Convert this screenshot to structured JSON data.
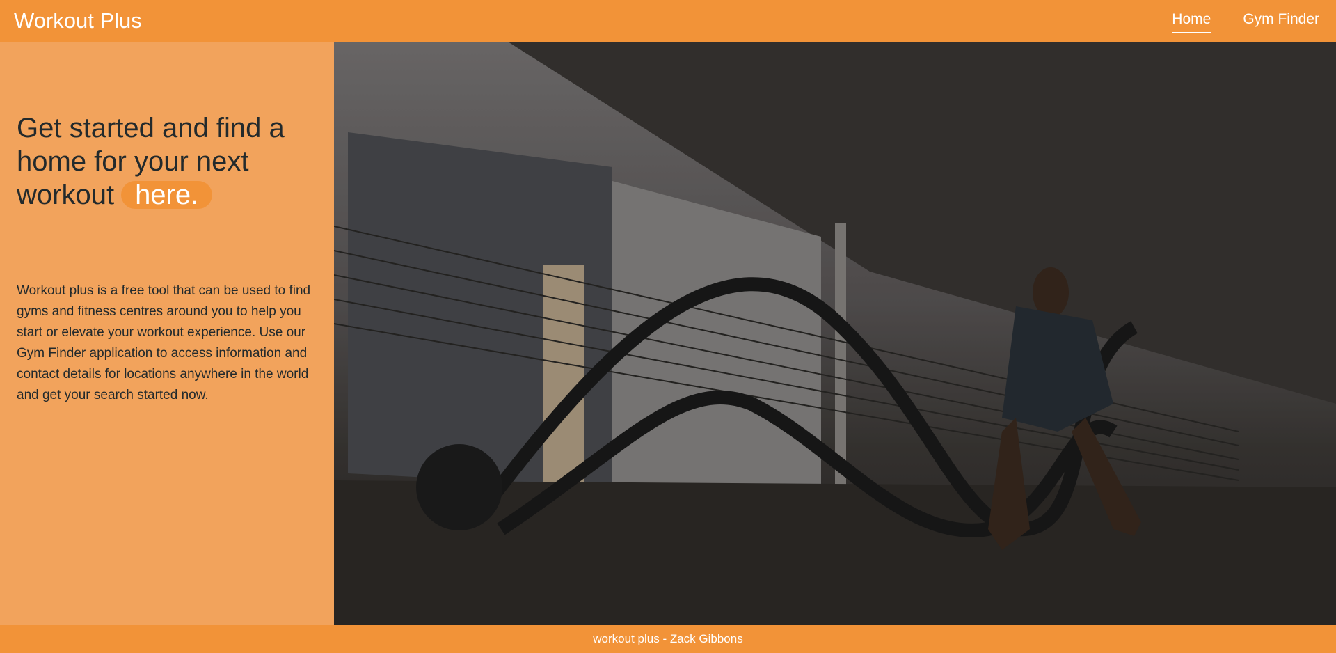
{
  "navbar": {
    "brand": "Workout Plus",
    "links": [
      {
        "label": "Home",
        "active": true
      },
      {
        "label": "Gym Finder",
        "active": false
      }
    ]
  },
  "intro": {
    "headline": "Get started and find a home for your next workout",
    "highlight": "here.",
    "description": "Workout plus is a free tool that can be used to find gyms and fitness centres around you to help you start or elevate your workout experience. Use our Gym Finder application to access information and contact details for locations anywhere in the world and get your search started now."
  },
  "hero": {
    "icon": "hero-photo-battle-ropes"
  },
  "footer": {
    "text": "workout plus - Zack Gibbons"
  },
  "colors": {
    "accent": "#f29338",
    "panel": "#f2a35c",
    "text_dark": "#232a2c"
  }
}
